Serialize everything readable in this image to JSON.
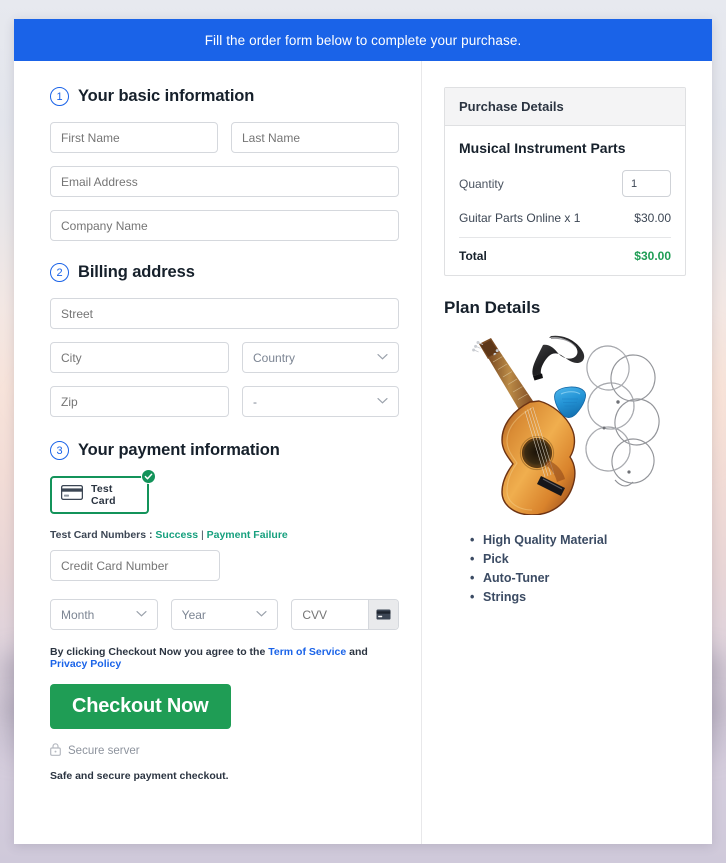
{
  "banner": {
    "text": "Fill the order form below to complete your purchase."
  },
  "steps": {
    "basic": {
      "num": "1",
      "title": "Your basic information"
    },
    "billing": {
      "num": "2",
      "title": "Billing address"
    },
    "payment": {
      "num": "3",
      "title": "Your payment information"
    }
  },
  "fields": {
    "first_name": {
      "placeholder": "First Name",
      "value": ""
    },
    "last_name": {
      "placeholder": "Last Name",
      "value": ""
    },
    "email": {
      "placeholder": "Email Address",
      "value": ""
    },
    "company": {
      "placeholder": "Company Name",
      "value": ""
    },
    "street": {
      "placeholder": "Street",
      "value": ""
    },
    "city": {
      "placeholder": "City",
      "value": ""
    },
    "country": {
      "selected": "Country"
    },
    "zip": {
      "placeholder": "Zip",
      "value": ""
    },
    "state": {
      "selected": "-"
    },
    "card_number": {
      "placeholder": "Credit Card Number",
      "value": ""
    },
    "month": {
      "selected": "Month"
    },
    "year": {
      "selected": "Year"
    },
    "cvv": {
      "placeholder": "CVV",
      "value": ""
    }
  },
  "payment": {
    "method_label": "Test  Card",
    "method_icon": "credit-card-icon",
    "selected_badge": "check-circle-icon",
    "test_numbers_label": "Test Card Numbers :",
    "success_link": "Success",
    "separator": "|",
    "failure_link": "Payment Failure"
  },
  "terms": {
    "prefix": "By clicking Checkout Now you agree to the",
    "tos_link": "Term of Service",
    "conjunction": "and",
    "privacy_link": "Privacy Policy"
  },
  "checkout": {
    "button_label": "Checkout Now",
    "secure_label": "Secure server",
    "secure_icon": "lock-icon",
    "safe_note": "Safe and secure payment checkout."
  },
  "purchase": {
    "header": "Purchase Details",
    "product_title": "Musical Instrument Parts",
    "quantity_label": "Quantity",
    "quantity_value": "1",
    "line_item_label": "Guitar Parts Online x 1",
    "line_item_amount": "$30.00",
    "total_label": "Total",
    "total_amount": "$30.00"
  },
  "plan": {
    "title": "Plan Details",
    "image_name": "acoustic-guitar-parts-image",
    "features": [
      "High Quality Material",
      "Pick",
      "Auto-Tuner",
      "Strings"
    ]
  },
  "colors": {
    "banner_blue": "#1a63e8",
    "accent_blue": "#1a63e8",
    "success_green": "#1f9d55",
    "card_border_green": "#13935a",
    "link_teal": "#17a07e"
  }
}
